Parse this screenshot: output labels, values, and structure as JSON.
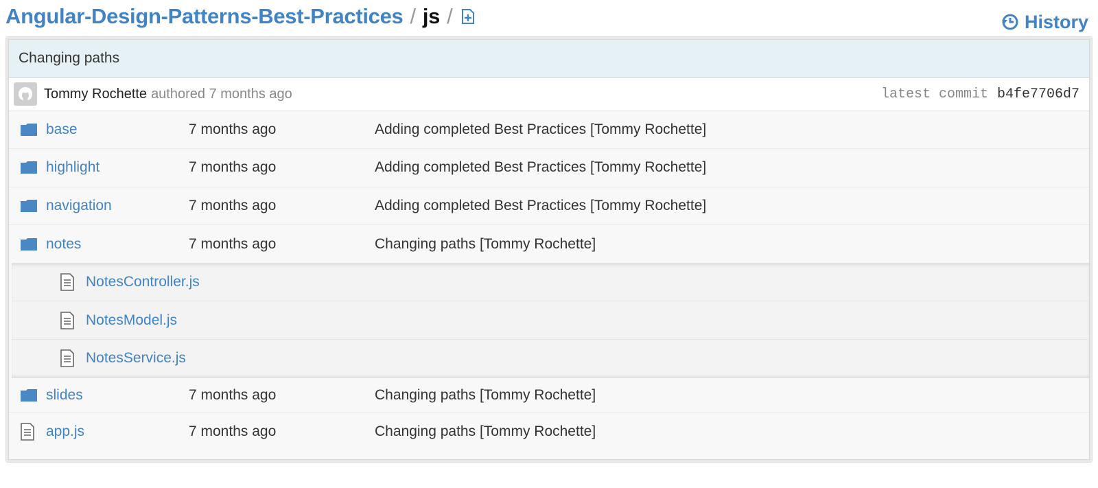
{
  "breadcrumb": {
    "repo": "Angular-Design-Patterns-Best-Practices",
    "separator": "/",
    "current": "js",
    "trailing_separator": "/",
    "new_file_icon": "new-file-icon"
  },
  "history": {
    "label": "History",
    "icon": "history-icon"
  },
  "commit": {
    "title": "Changing paths",
    "author": "Tommy Rochette",
    "authored_text": "authored 7 months ago",
    "latest_label": "latest commit",
    "sha": "b4fe7706d7",
    "avatar_icon": "octocat-avatar-icon"
  },
  "entries": [
    {
      "type": "directory",
      "name": "base",
      "age": "7 months ago",
      "message": "Adding completed Best Practices [Tommy Rochette]"
    },
    {
      "type": "directory",
      "name": "highlight",
      "age": "7 months ago",
      "message": "Adding completed Best Practices [Tommy Rochette]"
    },
    {
      "type": "directory",
      "name": "navigation",
      "age": "7 months ago",
      "message": "Adding completed Best Practices [Tommy Rochette]"
    },
    {
      "type": "directory",
      "name": "notes",
      "age": "7 months ago",
      "message": "Changing paths [Tommy Rochette]"
    },
    {
      "type": "directory",
      "name": "slides",
      "age": "7 months ago",
      "message": "Changing paths [Tommy Rochette]"
    },
    {
      "type": "file",
      "name": "app.js",
      "age": "7 months ago",
      "message": "Changing paths [Tommy Rochette]"
    }
  ],
  "notes_children": [
    {
      "type": "file",
      "name": "NotesController.js"
    },
    {
      "type": "file",
      "name": "NotesModel.js"
    },
    {
      "type": "file",
      "name": "NotesService.js"
    }
  ],
  "colors": {
    "link": "#4183c4",
    "folder": "#4a88c5",
    "header_bg": "#e6f1f6"
  }
}
